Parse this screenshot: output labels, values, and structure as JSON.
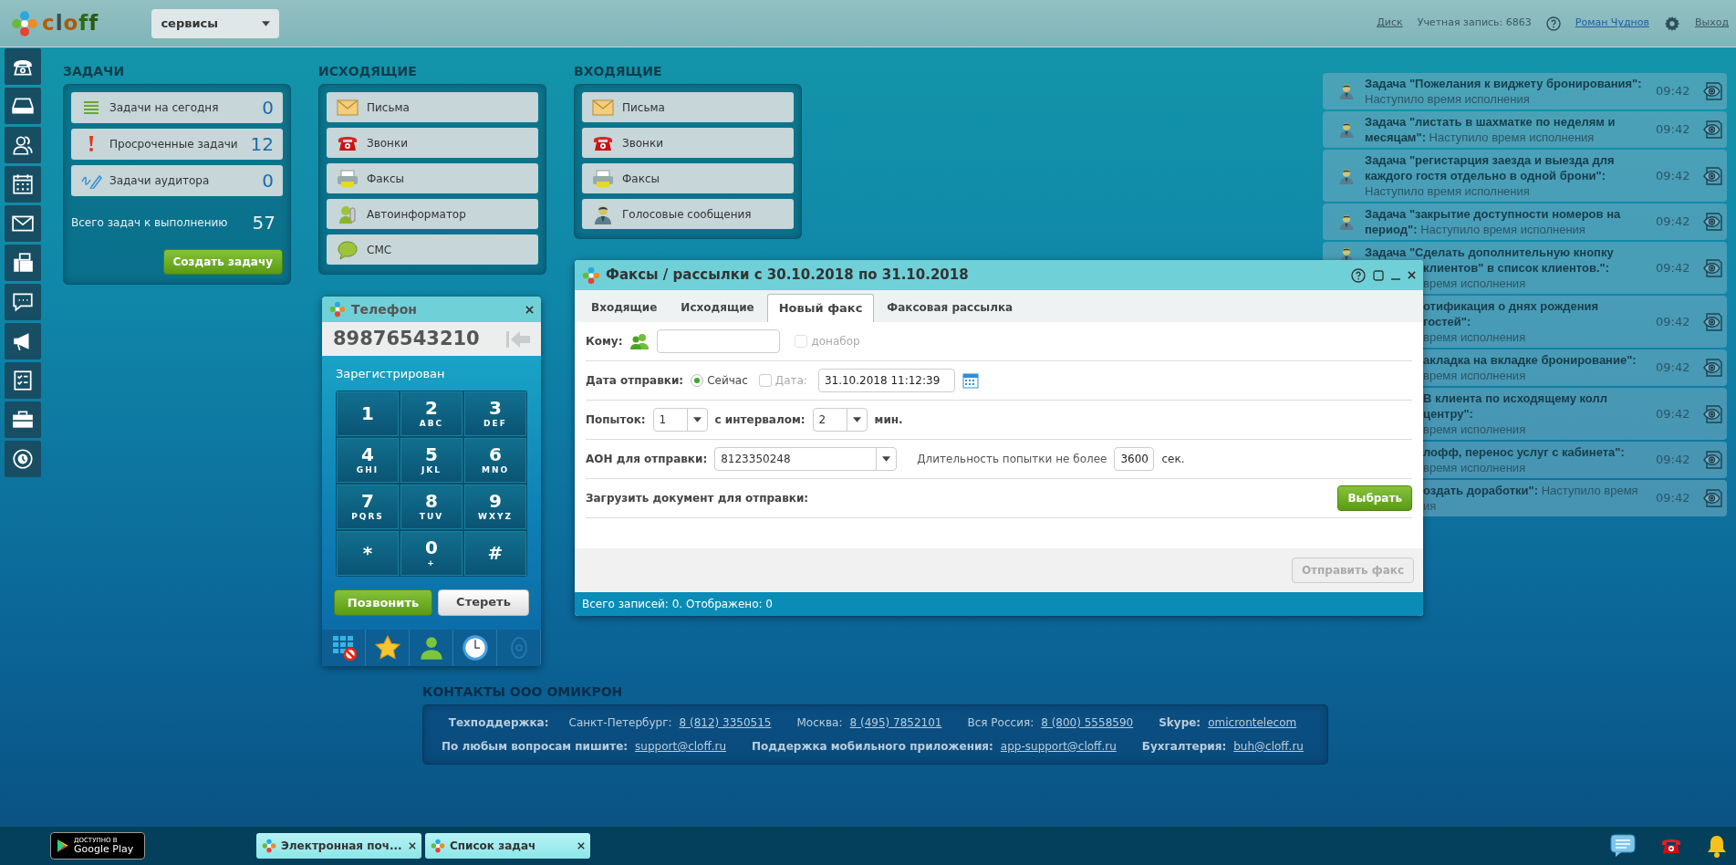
{
  "header": {
    "logo": "cloff",
    "services": "сервисы",
    "disk": "Диск",
    "account": "Учетная запись: 6863",
    "user": "Роман Чуднов",
    "logout": "Выход"
  },
  "tasks": {
    "title": "ЗАДАЧИ",
    "items": [
      {
        "kind": "today",
        "label": "Задачи на сегодня",
        "count": "0"
      },
      {
        "kind": "overdue",
        "label": "Просроченные задачи",
        "count": "12"
      },
      {
        "kind": "auditor",
        "label": "Задачи аудитора",
        "count": "0"
      }
    ],
    "total_label": "Всего задач к выполнению",
    "total": "57",
    "create": "Создать задачу"
  },
  "outgoing": {
    "title": "ИСХОДЯЩИЕ",
    "items": [
      {
        "kind": "letters",
        "label": "Письма"
      },
      {
        "kind": "calls",
        "label": "Звонки"
      },
      {
        "kind": "faxes",
        "label": "Факсы"
      },
      {
        "kind": "autoinform",
        "label": "Автоинформатор"
      },
      {
        "kind": "sms",
        "label": "СМС"
      }
    ]
  },
  "incoming": {
    "title": "ВХОДЯЩИЕ",
    "items": [
      {
        "kind": "letters",
        "label": "Письма"
      },
      {
        "kind": "calls",
        "label": "Звонки"
      },
      {
        "kind": "faxes",
        "label": "Факсы"
      },
      {
        "kind": "voice",
        "label": "Голосовые сообщения"
      }
    ]
  },
  "phone": {
    "title": "Телефон",
    "number": "89876543210",
    "status": "Зарегистрирован",
    "keys": [
      {
        "digit": "1"
      },
      {
        "digit": "2",
        "letters": "ABC"
      },
      {
        "digit": "3",
        "letters": "DEF"
      },
      {
        "digit": "4",
        "letters": "GHI"
      },
      {
        "digit": "5",
        "letters": "JKL"
      },
      {
        "digit": "6",
        "letters": "MNO"
      },
      {
        "digit": "7",
        "letters": "PQRS"
      },
      {
        "digit": "8",
        "letters": "TUV"
      },
      {
        "digit": "9",
        "letters": "WXYZ"
      },
      {
        "digit": "*"
      },
      {
        "digit": "0",
        "letters": "+"
      },
      {
        "digit": "#"
      }
    ],
    "call": "Позвонить",
    "clear": "Стереть"
  },
  "fax_window": {
    "title": "Факсы / рассылки с 30.10.2018 по 31.10.2018",
    "tabs": [
      {
        "label": "Входящие",
        "selected": false
      },
      {
        "label": "Исходящие",
        "selected": false
      },
      {
        "label": "Новый факс",
        "selected": true
      },
      {
        "label": "Факсовая рассылка",
        "selected": false
      }
    ],
    "to_label": "Кому:",
    "redial": {
      "label": "донабор",
      "checked": false,
      "disabled": true
    },
    "date_label": "Дата отправки:",
    "send_modes": [
      {
        "label": "Сейчас",
        "selected": true
      },
      {
        "label": "Дата:",
        "selected": false
      }
    ],
    "date_value": "31.10.2018 11:12:39",
    "attempts_label": "Попыток:",
    "attempts": "1",
    "interval_label": "с интервалом:",
    "interval": "2",
    "interval_unit": "мин.",
    "caller_label": "АОН для отправки:",
    "caller": "8123350248",
    "duration_label": "Длительность попытки не более",
    "duration": "3600",
    "duration_unit": "сек.",
    "upload_label": "Загрузить документ для отправки:",
    "choose": "Выбрать",
    "send": {
      "label": "Отправить факс",
      "disabled": true
    },
    "status": "Всего записей: 0. Отображено: 0"
  },
  "notifications": [
    {
      "kind": "full",
      "text": "**Задача \"Пожелания к виджету бронирования\":** Наступило время исполнения",
      "time": "09:42"
    },
    {
      "kind": "full",
      "text": "**Задача \"листать в шахматке по неделям и месяцам\":** Наступило время исполнения",
      "time": "09:42"
    },
    {
      "kind": "full",
      "text": "**Задача \"регистарция заезда и выезда для каждого гостя отдельно в одной брони\":** Наступило время исполнения",
      "time": "09:42"
    },
    {
      "kind": "full",
      "text": "**Задача \"закрытие доступности номеров на период\":** Наступило время исполнения",
      "time": "09:42"
    },
    {
      "kind": "cut",
      "head": "Задача \"Сделать дополнительную кнопку",
      "lines": [
        "**клиентов\" в список клиентов.\":**",
        "время исполнения"
      ],
      "time": "09:42"
    },
    {
      "kind": "cut",
      "lines": [
        "**отификация о днях рождения гостей\":**",
        "время исполнения"
      ],
      "time": "09:42"
    },
    {
      "kind": "cut",
      "lines": [
        "**акладка на вкладке бронирование\":**",
        "время исполнения"
      ],
      "time": "09:42"
    },
    {
      "kind": "cut",
      "lines": [
        "**В клиента по исходящему колл центру\":**",
        "время исполнения"
      ],
      "time": "09:42"
    },
    {
      "kind": "cut",
      "lines": [
        "**лофф, перенос услуг с кабинета\":**",
        "время исполнения"
      ],
      "time": "09:42"
    },
    {
      "kind": "cut",
      "lines": [
        "**оздать доработки\":** Наступило время",
        "ия"
      ],
      "time": "09:42"
    }
  ],
  "contacts": {
    "title": "КОНТАКТЫ ООО ОМИКРОН",
    "lines": [
      {
        "parts": [
          {
            "kind": "label",
            "text": "Техподдержка:"
          },
          {
            "kind": "text",
            "text": "Санкт-Петербург:"
          },
          {
            "kind": "link",
            "text": "8 (812) 3350515"
          },
          {
            "kind": "text",
            "text": "Москва:"
          },
          {
            "kind": "link",
            "text": "8 (495) 7852101"
          },
          {
            "kind": "text",
            "text": "Вся Россия:"
          },
          {
            "kind": "link",
            "text": "8 (800) 5558590"
          },
          {
            "kind": "label",
            "text": "Skype:"
          },
          {
            "kind": "link",
            "text": "omicrontelecom"
          }
        ]
      },
      {
        "parts": [
          {
            "kind": "label",
            "text": "По любым вопросам пишите:"
          },
          {
            "kind": "link",
            "text": "support@cloff.ru"
          },
          {
            "kind": "label",
            "text": "Поддержка мобильного приложения:"
          },
          {
            "kind": "link",
            "text": "app-support@cloff.ru"
          },
          {
            "kind": "label",
            "text": "Бухгалтерия:"
          },
          {
            "kind": "link",
            "text": "buh@cloff.ru"
          }
        ]
      }
    ]
  },
  "bottom_bar": {
    "store": {
      "small": "ДОСТУПНО В",
      "big": "Google Play"
    },
    "tasks": [
      {
        "label": "Электронная поч..."
      },
      {
        "label": "Список задач"
      }
    ]
  }
}
